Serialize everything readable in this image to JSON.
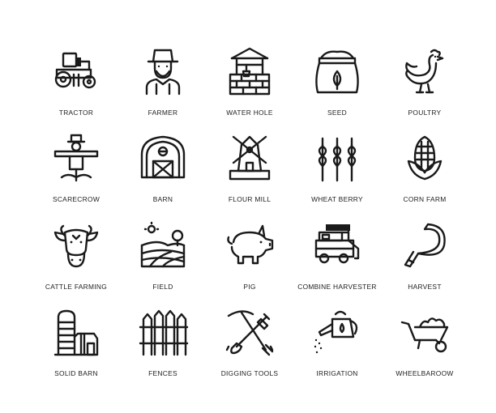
{
  "icons": [
    {
      "icon": "tractor-icon",
      "label": "TRACTOR"
    },
    {
      "icon": "farmer-icon",
      "label": "FARMER"
    },
    {
      "icon": "water-hole-icon",
      "label": "WATER HOLE"
    },
    {
      "icon": "seed-icon",
      "label": "SEED"
    },
    {
      "icon": "poultry-icon",
      "label": "POULTRY"
    },
    {
      "icon": "scarecrow-icon",
      "label": "SCARECROW"
    },
    {
      "icon": "barn-icon",
      "label": "BARN"
    },
    {
      "icon": "flour-mill-icon",
      "label": "FLOUR MILL"
    },
    {
      "icon": "wheat-berry-icon",
      "label": "WHEAT BERRY"
    },
    {
      "icon": "corn-farm-icon",
      "label": "CORN FARM"
    },
    {
      "icon": "cattle-farming-icon",
      "label": "CATTLE FARMING"
    },
    {
      "icon": "field-icon",
      "label": "FIELD"
    },
    {
      "icon": "pig-icon",
      "label": "PIG"
    },
    {
      "icon": "combine-harvester-icon",
      "label": "COMBINE HARVESTER"
    },
    {
      "icon": "harvest-icon",
      "label": "HARVEST"
    },
    {
      "icon": "solid-barn-icon",
      "label": "SOLID BARN"
    },
    {
      "icon": "fences-icon",
      "label": "FENCES"
    },
    {
      "icon": "digging-tools-icon",
      "label": "DIGGING TOOLS"
    },
    {
      "icon": "irrigation-icon",
      "label": "IRRIGATION"
    },
    {
      "icon": "wheelbarrow-icon",
      "label": "WHEELBAROOW"
    }
  ]
}
